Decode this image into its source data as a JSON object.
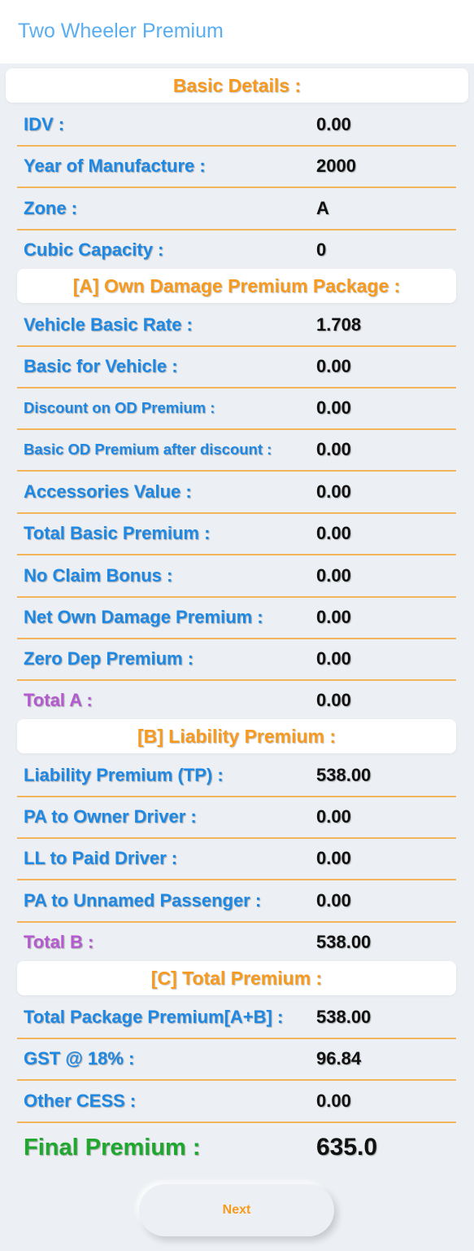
{
  "appbar": {
    "title": "Two Wheeler Premium"
  },
  "sections": {
    "basic": "Basic Details :",
    "own_damage": "[A] Own Damage Premium Package :",
    "liability": "[B] Liability Premium :",
    "total": "[C] Total Premium :"
  },
  "rows": {
    "idv": {
      "label": "IDV :",
      "value": "0.00"
    },
    "year": {
      "label": "Year of Manufacture :",
      "value": "2000"
    },
    "zone": {
      "label": "Zone :",
      "value": "A"
    },
    "cc": {
      "label": "Cubic Capacity :",
      "value": "0"
    },
    "vehicle_basic_rate": {
      "label": "Vehicle Basic Rate :",
      "value": "1.708"
    },
    "basic_for_vehicle": {
      "label": "Basic for Vehicle :",
      "value": "0.00"
    },
    "discount_od": {
      "label": "Discount on OD Premium :",
      "value": "0.00"
    },
    "basic_od_after_discount": {
      "label": "Basic OD Premium after discount :",
      "value": "0.00"
    },
    "accessories": {
      "label": "Accessories Value :",
      "value": "0.00"
    },
    "total_basic": {
      "label": "Total Basic Premium :",
      "value": "0.00"
    },
    "ncb": {
      "label": "No Claim Bonus :",
      "value": "0.00"
    },
    "net_od": {
      "label": "Net Own Damage Premium :",
      "value": "0.00"
    },
    "zero_dep": {
      "label": "Zero Dep Premium :",
      "value": "0.00"
    },
    "total_a": {
      "label": "Total A :",
      "value": "0.00"
    },
    "liability_tp": {
      "label": "Liability Premium (TP) :",
      "value": "538.00"
    },
    "pa_owner": {
      "label": "PA to Owner Driver :",
      "value": "0.00"
    },
    "ll_driver": {
      "label": "LL to Paid Driver :",
      "value": "0.00"
    },
    "pa_unnamed": {
      "label": "PA to Unnamed Passenger :",
      "value": "0.00"
    },
    "total_b": {
      "label": "Total B :",
      "value": "538.00"
    },
    "total_package": {
      "label": "Total Package Premium[A+B] :",
      "value": "538.00"
    },
    "gst": {
      "label": "GST @ 18% :",
      "value": "96.84"
    },
    "other_cess": {
      "label": "Other CESS :",
      "value": "0.00"
    },
    "final": {
      "label": "Final Premium :",
      "value": "635.0"
    }
  },
  "next_button": {
    "label": "Next"
  },
  "colors": {
    "label_blue": "#1e88e5",
    "accent_orange": "#f79a1e",
    "total_purple": "#b55ad0",
    "final_green": "#1fa82e",
    "title_blue": "#5aaef0"
  }
}
